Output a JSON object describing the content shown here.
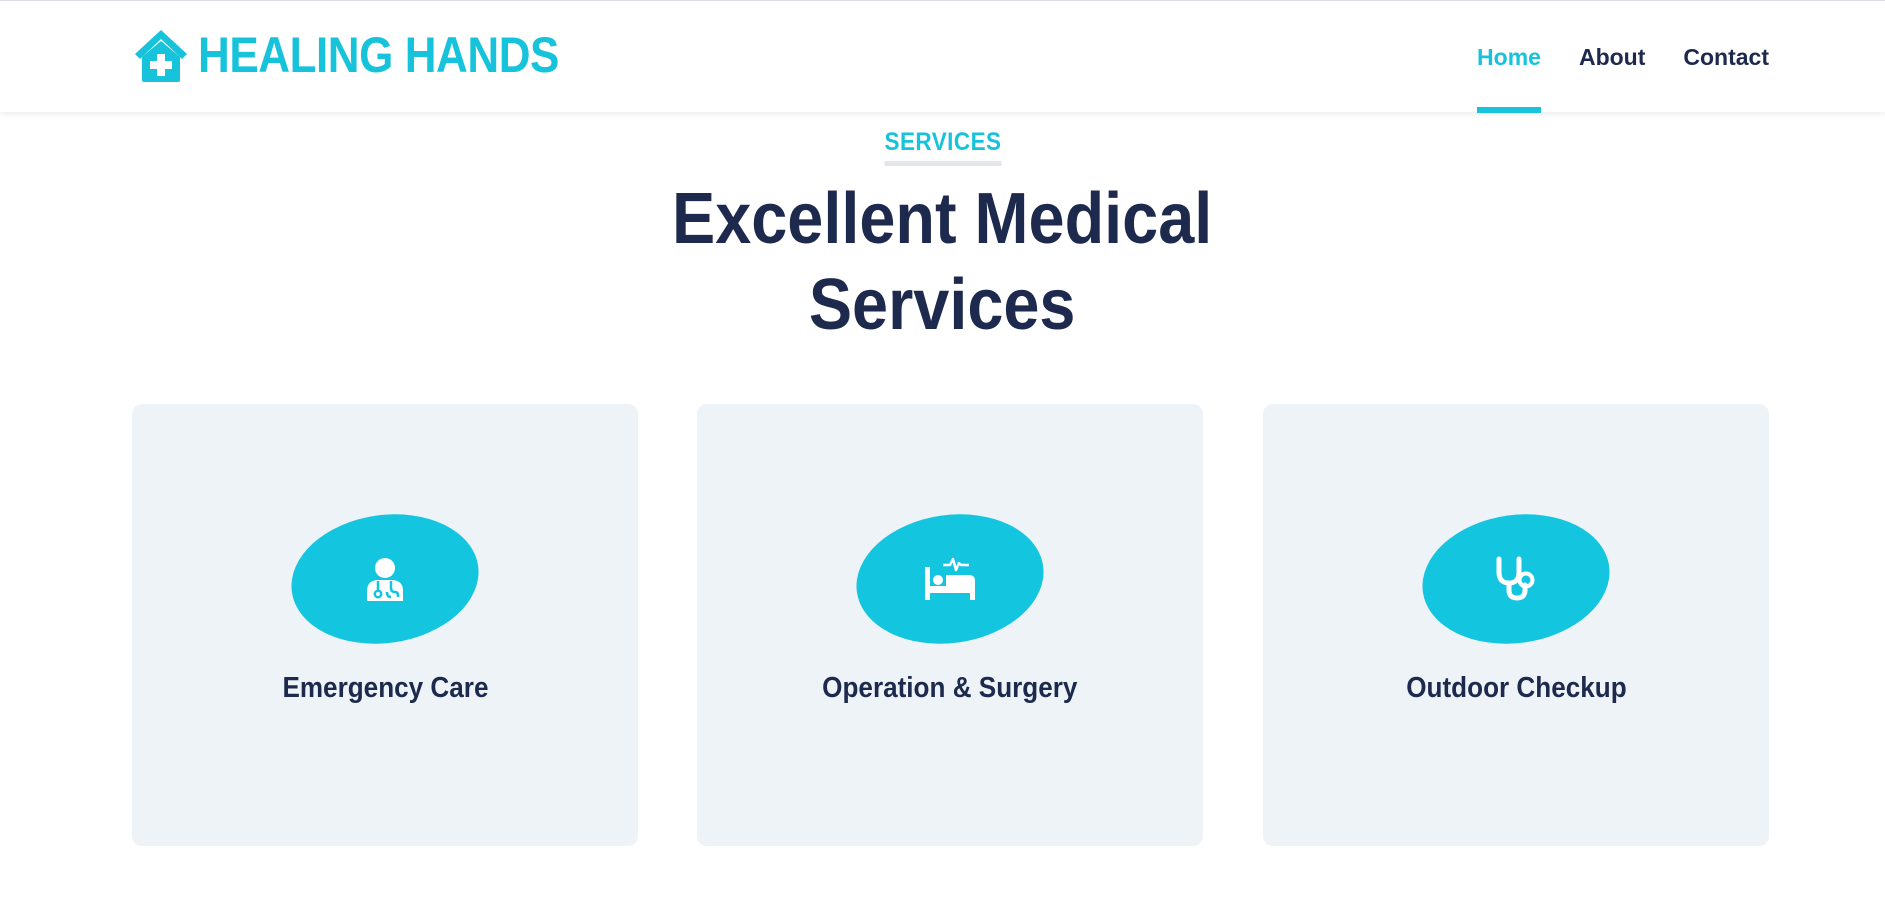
{
  "brand": {
    "name": "HEALING HANDS",
    "icon": "home-medical-icon",
    "color": "#17c3db"
  },
  "nav": {
    "items": [
      {
        "label": "Home",
        "active": true
      },
      {
        "label": "About",
        "active": false
      },
      {
        "label": "Contact",
        "active": false
      }
    ]
  },
  "section": {
    "eyebrow": "SERVICES",
    "title_line1": "Excellent Medical",
    "title_line2": "Services"
  },
  "services": [
    {
      "title": "Emergency Care",
      "icon": "doctor-icon"
    },
    {
      "title": "Operation & Surgery",
      "icon": "hospital-bed-icon"
    },
    {
      "title": "Outdoor Checkup",
      "icon": "stethoscope-icon"
    }
  ],
  "colors": {
    "accent": "#17c3db",
    "heading": "#1d2a4d",
    "card_bg": "#eef3f8"
  }
}
